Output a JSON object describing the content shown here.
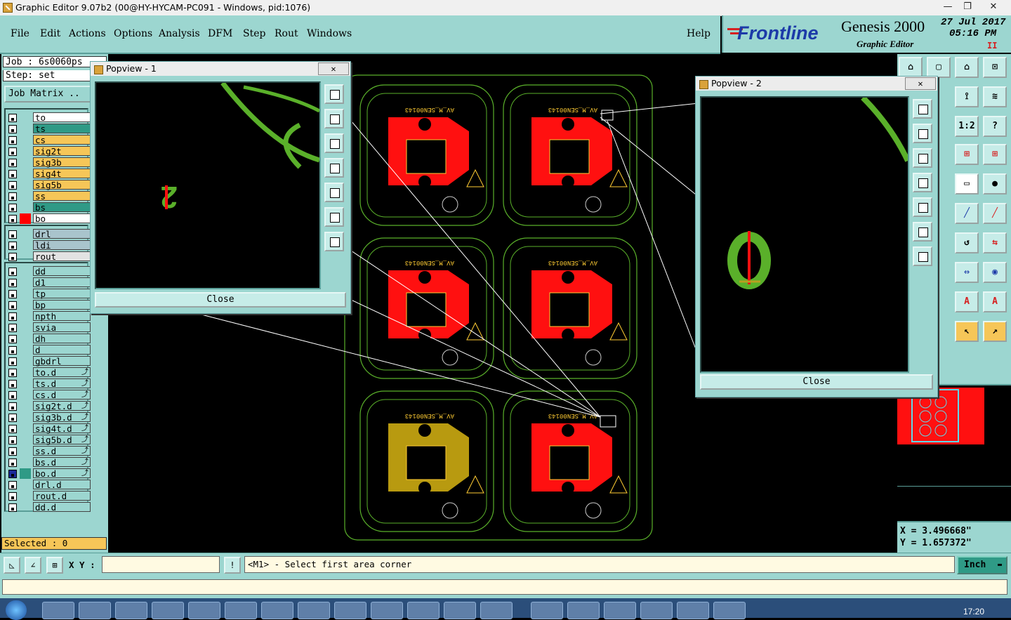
{
  "window": {
    "title": "Graphic Editor 9.07b2 (00@HY-HYCAM-PC091 - Windows, pid:1076)",
    "controls": {
      "minimize": "—",
      "restore": "❐",
      "close": "✕"
    }
  },
  "menubar": {
    "items": [
      "File",
      "Edit",
      "Actions",
      "Options",
      "Analysis",
      "DFM",
      "Step",
      "Rout",
      "Windows"
    ],
    "help": "Help"
  },
  "brand": {
    "logo": "Frontline",
    "product": "Genesis 2000",
    "subtitle": "Graphic Editor",
    "date": "27 Jul 2017",
    "time": "05:16 PM",
    "pause": "II"
  },
  "job": {
    "job_label": "Job : 6s0060ps",
    "step_label": "Step: set",
    "matrix_button": "Job Matrix .."
  },
  "layers": {
    "group1": [
      {
        "name": "to",
        "color": "#ffffff"
      },
      {
        "name": "ts",
        "color": "#2f9a86"
      },
      {
        "name": "cs",
        "color": "#f6c658"
      },
      {
        "name": "sig2t",
        "color": "#f6c658"
      },
      {
        "name": "sig3b",
        "color": "#f6c658"
      },
      {
        "name": "sig4t",
        "color": "#f6c658"
      },
      {
        "name": "sig5b",
        "color": "#f6c658"
      },
      {
        "name": "ss",
        "color": "#f6c658"
      },
      {
        "name": "bs",
        "color": "#2f9a86"
      },
      {
        "name": "bo",
        "color": "#ffffff",
        "display": "#ff0000"
      }
    ],
    "group2": [
      {
        "name": "drl",
        "color": "#a9c4cc"
      },
      {
        "name": "ldi",
        "color": "#a9c4cc"
      },
      {
        "name": "rout",
        "color": "#e2e2e2"
      }
    ],
    "group3": [
      {
        "name": "dd",
        "flag": ""
      },
      {
        "name": "d1",
        "flag": ""
      },
      {
        "name": "tp",
        "flag": ""
      },
      {
        "name": "bp",
        "flag": ""
      },
      {
        "name": "npth",
        "flag": ""
      },
      {
        "name": "svia",
        "flag": ""
      },
      {
        "name": "dh",
        "flag": ""
      },
      {
        "name": "d",
        "flag": ""
      },
      {
        "name": "gbdrl",
        "flag": ""
      },
      {
        "name": "to.d",
        "flag": "⤴"
      },
      {
        "name": "ts.d",
        "flag": "⤴"
      },
      {
        "name": "cs.d",
        "flag": "⤴"
      },
      {
        "name": "sig2t.d",
        "flag": "⤴"
      },
      {
        "name": "sig3b.d",
        "flag": "⤴"
      },
      {
        "name": "sig4t.d",
        "flag": "⤴"
      },
      {
        "name": "sig5b.d",
        "flag": "⤴"
      },
      {
        "name": "ss.d",
        "flag": "⤴"
      },
      {
        "name": "bs.d",
        "flag": "⤴"
      },
      {
        "name": "bo.d",
        "flag": "⤴",
        "work": true
      },
      {
        "name": "drl.d",
        "flag": ""
      },
      {
        "name": "rout.d",
        "flag": ""
      },
      {
        "name": "dd.d",
        "flag": ""
      }
    ],
    "layer_color": "#9cd6d0"
  },
  "selected": "Selected : 0",
  "popview1": {
    "title": "Popview - 1",
    "close": "Close",
    "close_x": "✕"
  },
  "popview2": {
    "title": "Popview - 2",
    "close": "Close",
    "close_x": "✕"
  },
  "board": {
    "part_label": "AV_M_SEN00143",
    "colors": {
      "copper": "#ff1010",
      "outline": "#5ab02a",
      "selected_panel": "#b89a10",
      "silk": "#ffcc33"
    }
  },
  "right_tools": {
    "labels": [
      "1:2",
      "?"
    ]
  },
  "coords": {
    "x": "X = 3.496668\"",
    "y": "Y = 1.657372\""
  },
  "command": {
    "xy_label": "X Y :",
    "xy_value": "",
    "info_btn": "!",
    "prompt": "<M1> - Select first area corner",
    "unit": "Inch"
  },
  "taskbar": {
    "clock": "17:20"
  }
}
